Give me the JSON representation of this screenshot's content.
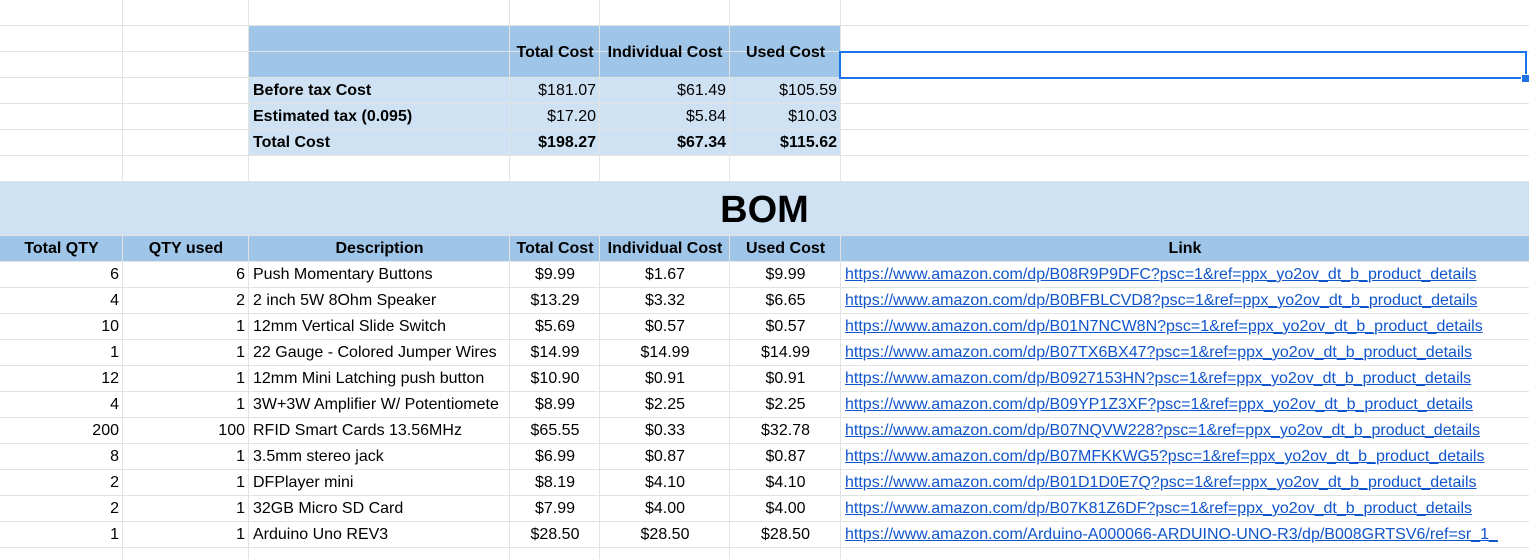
{
  "summary": {
    "headers": [
      "Total Cost",
      "Individual Cost",
      "Used Cost"
    ],
    "rows": [
      {
        "label": "Before tax Cost",
        "values": [
          "$181.07",
          "$61.49",
          "$105.59"
        ]
      },
      {
        "label": "Estimated tax (0.095)",
        "values": [
          "$17.20",
          "$5.84",
          "$10.03"
        ]
      },
      {
        "label": "Total Cost",
        "values": [
          "$198.27",
          "$67.34",
          "$115.62"
        ]
      }
    ]
  },
  "bom": {
    "title": "BOM",
    "headers": [
      "Total QTY",
      "QTY used",
      "Description",
      "Total Cost",
      "Individual Cost",
      "Used Cost",
      "Link"
    ],
    "rows": [
      [
        "6",
        "6",
        "Push Momentary Buttons",
        "$9.99",
        "$1.67",
        "$9.99",
        "https://www.amazon.com/dp/B08R9P9DFC?psc=1&ref=ppx_yo2ov_dt_b_product_details"
      ],
      [
        "4",
        "2",
        "2 inch 5W 8Ohm Speaker",
        "$13.29",
        "$3.32",
        "$6.65",
        "https://www.amazon.com/dp/B0BFBLCVD8?psc=1&ref=ppx_yo2ov_dt_b_product_details"
      ],
      [
        "10",
        "1",
        "12mm Vertical Slide Switch",
        "$5.69",
        "$0.57",
        "$0.57",
        "https://www.amazon.com/dp/B01N7NCW8N?psc=1&ref=ppx_yo2ov_dt_b_product_details"
      ],
      [
        "1",
        "1",
        "22 Gauge - Colored Jumper Wires",
        "$14.99",
        "$14.99",
        "$14.99",
        "https://www.amazon.com/dp/B07TX6BX47?psc=1&ref=ppx_yo2ov_dt_b_product_details"
      ],
      [
        "12",
        "1",
        "12mm Mini Latching push button",
        "$10.90",
        "$0.91",
        "$0.91",
        "https://www.amazon.com/dp/B0927153HN?psc=1&ref=ppx_yo2ov_dt_b_product_details"
      ],
      [
        "4",
        "1",
        "3W+3W Amplifier W/ Potentiomete",
        "$8.99",
        "$2.25",
        "$2.25",
        "https://www.amazon.com/dp/B09YP1Z3XF?psc=1&ref=ppx_yo2ov_dt_b_product_details"
      ],
      [
        "200",
        "100",
        "RFID Smart Cards 13.56MHz",
        "$65.55",
        "$0.33",
        "$32.78",
        "https://www.amazon.com/dp/B07NQVW228?psc=1&ref=ppx_yo2ov_dt_b_product_details"
      ],
      [
        "8",
        "1",
        "3.5mm stereo jack",
        "$6.99",
        "$0.87",
        "$0.87",
        "https://www.amazon.com/dp/B07MFKKWG5?psc=1&ref=ppx_yo2ov_dt_b_product_details"
      ],
      [
        "2",
        "1",
        "DFPlayer mini",
        "$8.19",
        "$4.10",
        "$4.10",
        "https://www.amazon.com/dp/B01D1D0E7Q?psc=1&ref=ppx_yo2ov_dt_b_product_details"
      ],
      [
        "2",
        "1",
        "32GB Micro SD Card",
        "$7.99",
        "$4.00",
        "$4.00",
        "https://www.amazon.com/dp/B07K81Z6DF?psc=1&ref=ppx_yo2ov_dt_b_product_details"
      ],
      [
        "1",
        "1",
        "Arduino Uno REV3",
        "$28.50",
        "$28.50",
        "$28.50",
        "https://www.amazon.com/Arduino-A000066-ARDUINO-UNO-R3/dp/B008GRTSV6/ref=sr_1_"
      ]
    ]
  },
  "colors": {
    "header_fill": "#9fc5e8",
    "band_fill": "#cfe2f3",
    "gridline": "#e2e3e3",
    "link": "#1155cc",
    "selection": "#1a73e8"
  }
}
